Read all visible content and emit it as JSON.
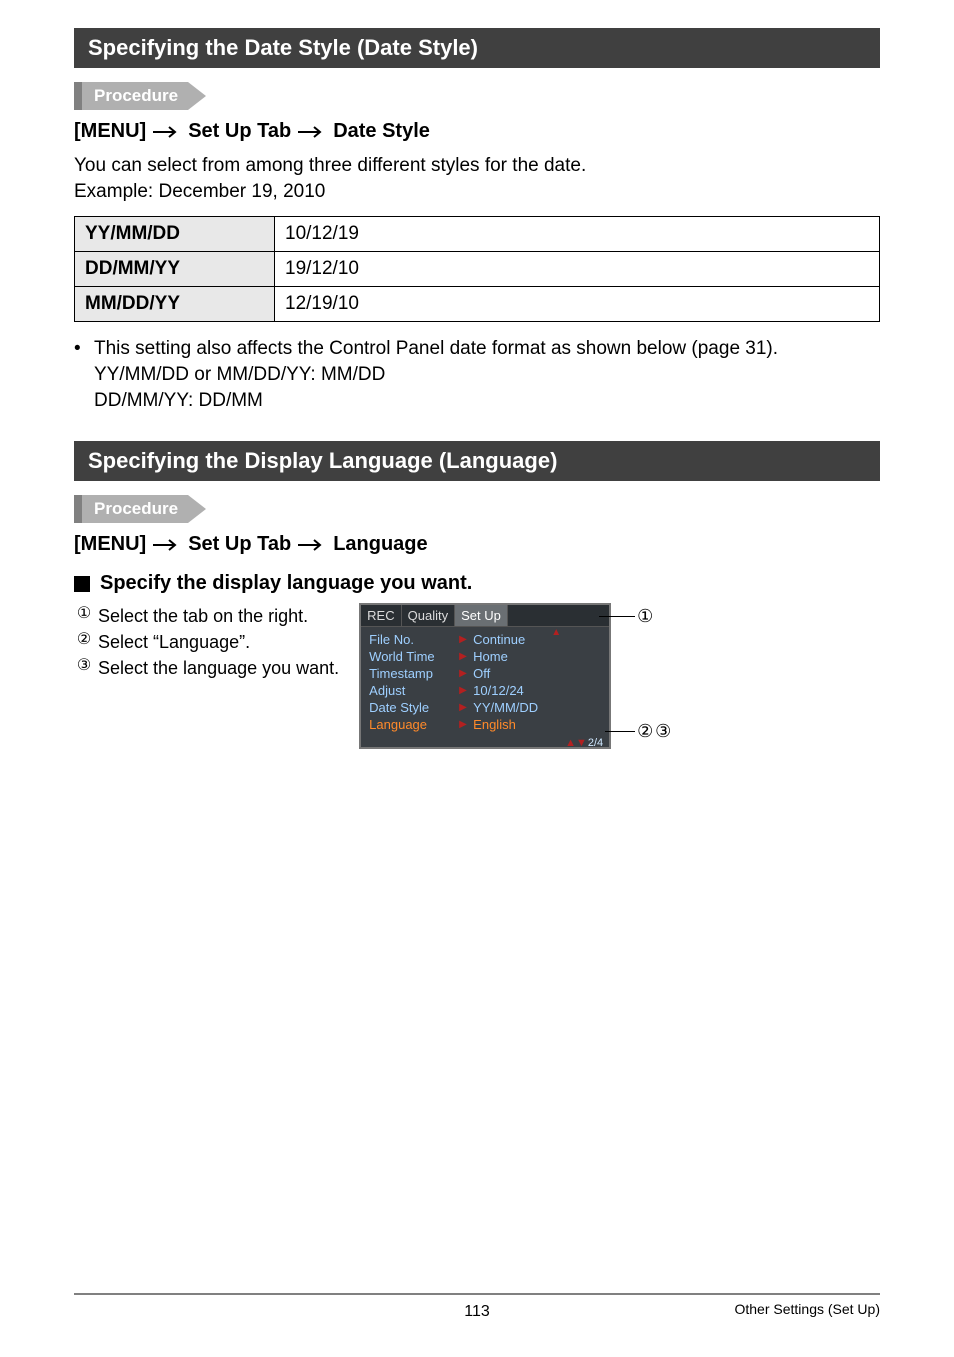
{
  "section1": {
    "title": "Specifying the Date Style (Date Style)",
    "procedure_label": "Procedure",
    "nav": {
      "a": "[MENU]",
      "b": "Set Up Tab",
      "c": "Date Style"
    },
    "intro_line1": "You can select from among three different styles for the date.",
    "intro_line2": "Example: December 19, 2010",
    "table": {
      "rows": [
        {
          "fmt": "YY/MM/DD",
          "ex": "10/12/19"
        },
        {
          "fmt": "DD/MM/YY",
          "ex": "19/12/10"
        },
        {
          "fmt": "MM/DD/YY",
          "ex": "12/19/10"
        }
      ]
    },
    "note": {
      "line1": "This setting also affects the Control Panel date format as shown below (page 31).",
      "line2": "YY/MM/DD or MM/DD/YY: MM/DD",
      "line3": "DD/MM/YY: DD/MM"
    }
  },
  "section2": {
    "title": "Specifying the Display Language (Language)",
    "procedure_label": "Procedure",
    "nav": {
      "a": "[MENU]",
      "b": "Set Up Tab",
      "c": "Language"
    },
    "subhead": "Specify the display language you want.",
    "steps": [
      "Select the tab on the right.",
      "Select “Language”.",
      "Select the language you want."
    ],
    "callouts": {
      "c1": "①",
      "c2": "②",
      "c3": "③"
    },
    "camera_menu": {
      "tabs": {
        "rec": "REC",
        "quality": "Quality",
        "setup": "Set Up"
      },
      "rows": [
        {
          "label": "File No.",
          "value": "Continue"
        },
        {
          "label": "World Time",
          "value": "Home"
        },
        {
          "label": "Timestamp",
          "value": "Off"
        },
        {
          "label": "Adjust",
          "value": "10/12/24"
        },
        {
          "label": "Date Style",
          "value": "YY/MM/DD"
        },
        {
          "label": "Language",
          "value": "English",
          "selected": true
        }
      ],
      "page_indicator": "2/4"
    }
  },
  "footer": {
    "page_number": "113",
    "section_name": "Other Settings (Set Up)"
  }
}
